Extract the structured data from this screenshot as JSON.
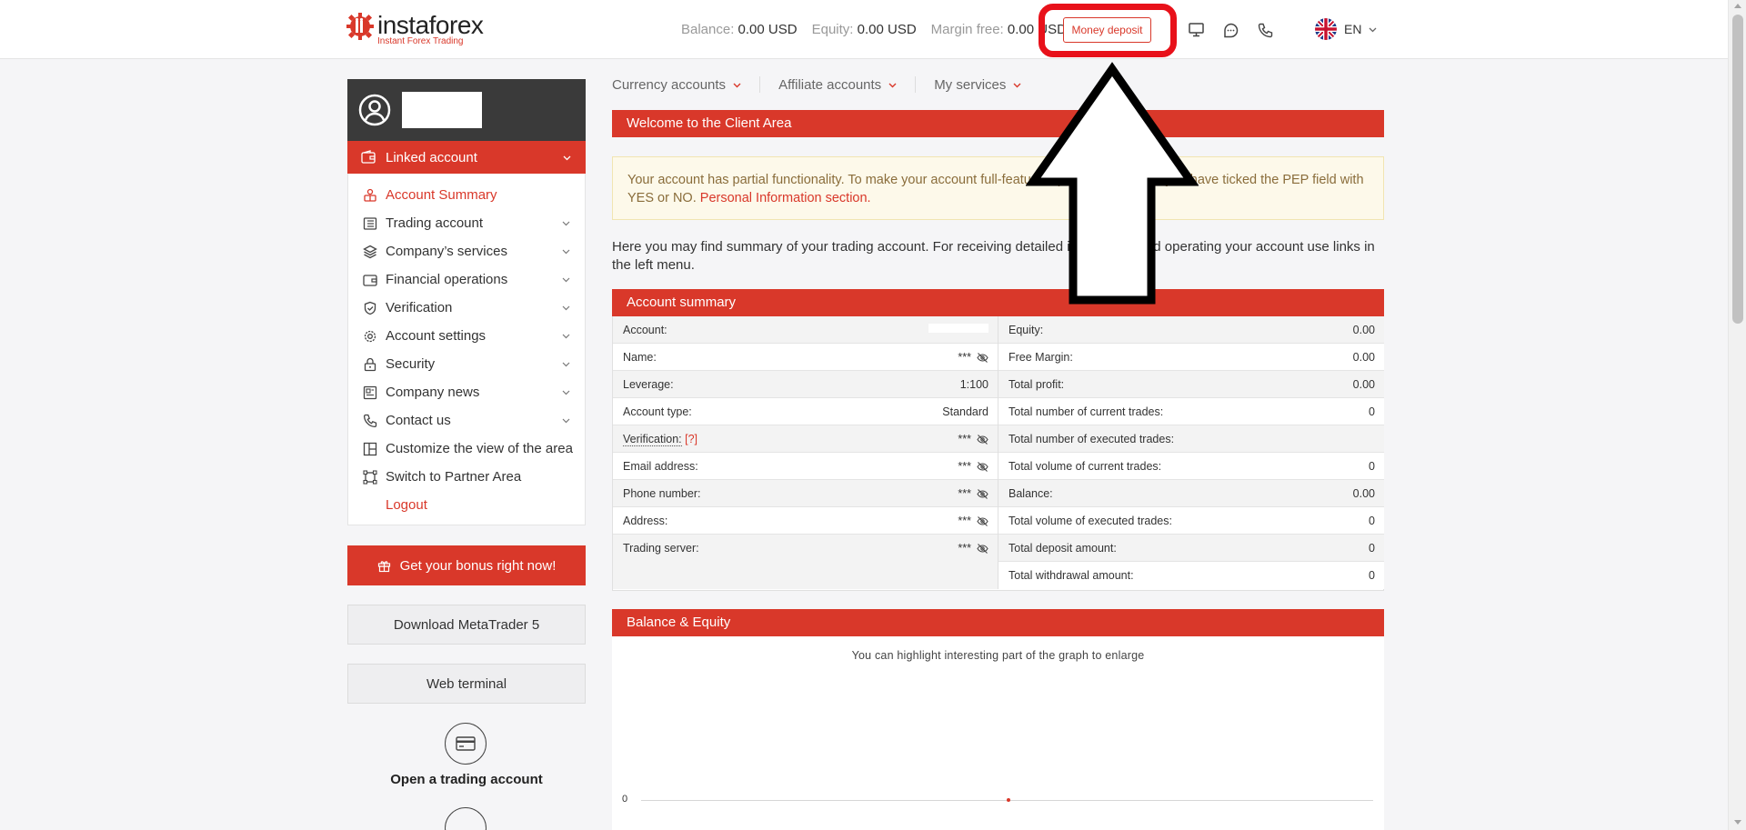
{
  "header": {
    "brand_name": "instaforex",
    "brand_tagline": "Instant Forex Trading",
    "balance_label": "Balance:",
    "balance_value": "0.00 USD",
    "equity_label": "Equity:",
    "equity_value": "0.00 USD",
    "margin_label": "Margin free:",
    "margin_value": "0.00 USD",
    "deposit_button": "Money deposit",
    "language": "EN",
    "icons": [
      "monitor-icon",
      "chat-icon",
      "phone-icon",
      "uk-flag-icon"
    ]
  },
  "sidebar": {
    "linked_account": "Linked account",
    "items": [
      {
        "label": "Account Summary",
        "icon": "account-summary-icon",
        "chevron": false
      },
      {
        "label": "Trading account",
        "icon": "trading-account-icon",
        "chevron": true
      },
      {
        "label": "Company’s services",
        "icon": "layers-icon",
        "chevron": true
      },
      {
        "label": "Financial operations",
        "icon": "wallet-icon",
        "chevron": true
      },
      {
        "label": "Verification",
        "icon": "shield-check-icon",
        "chevron": true
      },
      {
        "label": "Account settings",
        "icon": "gear-icon",
        "chevron": true
      },
      {
        "label": "Security",
        "icon": "lock-icon",
        "chevron": true
      },
      {
        "label": "Company news",
        "icon": "newspaper-icon",
        "chevron": true
      },
      {
        "label": "Contact us",
        "icon": "phone-icon",
        "chevron": true
      },
      {
        "label": "Customize the view of the area",
        "icon": "layout-icon",
        "chevron": false
      },
      {
        "label": "Switch to Partner Area",
        "icon": "switch-icon",
        "chevron": false
      },
      {
        "label": "Logout",
        "icon": "",
        "chevron": false
      }
    ],
    "bonus_button": "Get your bonus right now!",
    "download_button": "Download MetaTrader 5",
    "web_terminal_button": "Web terminal",
    "open_account_label": "Open a trading account"
  },
  "tabs": [
    {
      "label": "Currency accounts"
    },
    {
      "label": "Affiliate accounts"
    },
    {
      "label": "My services"
    }
  ],
  "welcome": {
    "title": "Welcome to the Client Area",
    "notice_text": "Your account has partial functionality. To make your account full-featured, please make sure you have ticked the PEP field with YES or NO.",
    "notice_link": "Personal Information section.",
    "intro": "Here you may find summary of your trading account. For receiving detailed information and operating your account use links in the left menu."
  },
  "summary": {
    "title": "Account summary",
    "left": [
      {
        "label": "Account:",
        "value": "",
        "masked": false,
        "blank": true
      },
      {
        "label": "Name:",
        "value": "***",
        "masked": true
      },
      {
        "label": "Leverage:",
        "value": "1:100",
        "masked": false
      },
      {
        "label": "Account type:",
        "value": "Standard",
        "masked": false
      },
      {
        "label": "Verification:",
        "help": "[?]",
        "value": "***",
        "masked": true
      },
      {
        "label": "Email address:",
        "value": "***",
        "masked": true
      },
      {
        "label": "Phone number:",
        "value": "***",
        "masked": true
      },
      {
        "label": "Address:",
        "value": "***",
        "masked": true
      },
      {
        "label": "Trading server:",
        "value": "***",
        "masked": true
      }
    ],
    "right": [
      {
        "label": "Equity:",
        "value": "0.00"
      },
      {
        "label": "Free Margin:",
        "value": "0.00"
      },
      {
        "label": "Total profit:",
        "value": "0.00"
      },
      {
        "label": "Total number of current trades:",
        "value": "0"
      },
      {
        "label": "Total number of executed trades:",
        "value": ""
      },
      {
        "label": "Total volume of current trades:",
        "value": "0"
      },
      {
        "label": "Balance:",
        "value": "0.00"
      },
      {
        "label": "Total volume of executed trades:",
        "value": "0"
      },
      {
        "label": "Total deposit amount:",
        "value": "0"
      },
      {
        "label": "Total withdrawal amount:",
        "value": "0"
      }
    ]
  },
  "balance_equity": {
    "title": "Balance & Equity",
    "note": "You can highlight interesting part of the graph to enlarge",
    "zero_label": "0"
  },
  "colors": {
    "accent": "#d9382a",
    "highlight_ring": "#e8111a",
    "notice_bg": "#fdf9ea"
  }
}
